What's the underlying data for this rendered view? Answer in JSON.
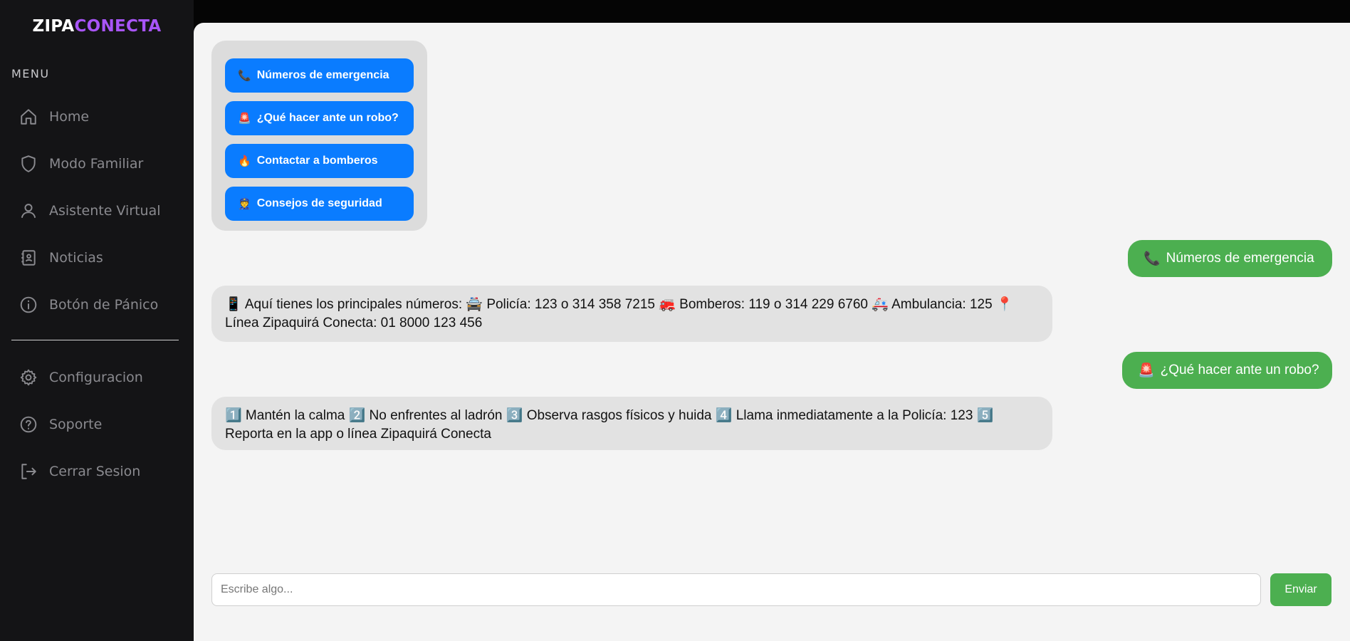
{
  "brand": {
    "part1": "ZIPA",
    "part2": "CONECTA"
  },
  "menu": {
    "title": "MENU",
    "items": [
      {
        "label": "Home",
        "icon": "home-icon"
      },
      {
        "label": "Modo Familiar",
        "icon": "shield-icon"
      },
      {
        "label": "Asistente Virtual",
        "icon": "user-icon"
      },
      {
        "label": "Noticias",
        "icon": "contact-card-icon"
      },
      {
        "label": "Botón de Pánico",
        "icon": "info-icon"
      }
    ],
    "bottom_items": [
      {
        "label": "Configuracion",
        "icon": "gear-icon"
      },
      {
        "label": "Soporte",
        "icon": "help-icon"
      },
      {
        "label": "Cerrar Sesion",
        "icon": "logout-icon"
      }
    ]
  },
  "quick_actions": [
    {
      "emoji": "📞",
      "label": "Números de emergencia"
    },
    {
      "emoji": "🚨",
      "label": "¿Qué hacer ante un robo?"
    },
    {
      "emoji": "🔥",
      "label": "Contactar a bomberos"
    },
    {
      "emoji": "👮",
      "label": "Consejos de seguridad"
    }
  ],
  "messages": [
    {
      "from": "user",
      "emoji": "📞",
      "text": "Números de emergencia"
    },
    {
      "from": "bot",
      "text": "📱 Aquí tienes los principales números: 🚔 Policía: 123 o 314 358 7215 🚒 Bomberos: 119 o 314 229 6760 🚑 Ambulancia: 125 📍 Línea Zipaquirá Conecta: 01 8000 123 456"
    },
    {
      "from": "user",
      "emoji": "🚨",
      "text": "¿Qué hacer ante un robo?"
    },
    {
      "from": "bot",
      "text": "1️⃣ Mantén la calma 2️⃣ No enfrentes al ladrón 3️⃣ Observa rasgos físicos y huida 4️⃣ Llama inmediatamente a la Policía: 123 5️⃣ Reporta en la app o línea Zipaquirá Conecta"
    }
  ],
  "composer": {
    "placeholder": "Escribe algo...",
    "send_label": "Enviar"
  },
  "colors": {
    "accent_blue": "#0a7cff",
    "accent_green": "#4caf50",
    "brand_purple": "#a855f7",
    "sidebar_bg": "#141416"
  }
}
